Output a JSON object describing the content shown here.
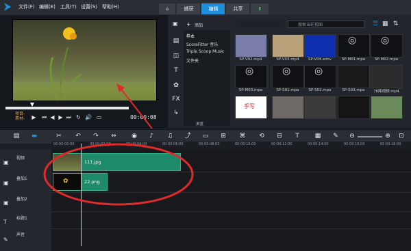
{
  "menu": {
    "file": "文件(F)",
    "edit": "编辑(E)",
    "tools": "工具(T)",
    "settings": "设置(S)",
    "help": "帮助(H)"
  },
  "workspace_tabs": {
    "capture": "捕获",
    "edit": "编辑",
    "share": "共享"
  },
  "preview": {
    "mode_project": "项目-",
    "mode_clip": "素材-",
    "timecode": "00:00:08"
  },
  "library": {
    "add_label": "添加",
    "search_placeholder": "搜索当前视图",
    "folders": [
      "样本",
      "ScoreFitter 音乐",
      "Triple Scoop Music",
      "文件夹"
    ],
    "browse_label": "浏览",
    "thumbs": [
      {
        "label": "SP-V02.mp4"
      },
      {
        "label": "SP-V03.mp4"
      },
      {
        "label": "SP-V04.wmv"
      },
      {
        "label": "SP-M01.mpa"
      },
      {
        "label": "SP-M02.mpa"
      },
      {
        "label": "SP-M03.mpa"
      },
      {
        "label": "SP-S01.mpa"
      },
      {
        "label": "SP-S02.mpa"
      },
      {
        "label": "SP-S03.mpa"
      },
      {
        "label": "76降视频.mp4"
      },
      {
        "label": "手写"
      },
      {
        "label": ""
      },
      {
        "label": ""
      },
      {
        "label": ""
      },
      {
        "label": ""
      }
    ]
  },
  "timeline": {
    "ruler": [
      "00:00:00:00",
      "00:00:02:00",
      "00:00:04:00",
      "00:00:06:00",
      "00:00:08:00",
      "00:00:10:00",
      "00:00:12:00",
      "00:00:14:00",
      "00:00:16:00",
      "00:00:18:00"
    ],
    "tracks": [
      "视频",
      "叠加1",
      "叠加2",
      "标题1",
      "声音"
    ],
    "clips": {
      "video": "111.jpg",
      "overlay": "22.png"
    }
  }
}
